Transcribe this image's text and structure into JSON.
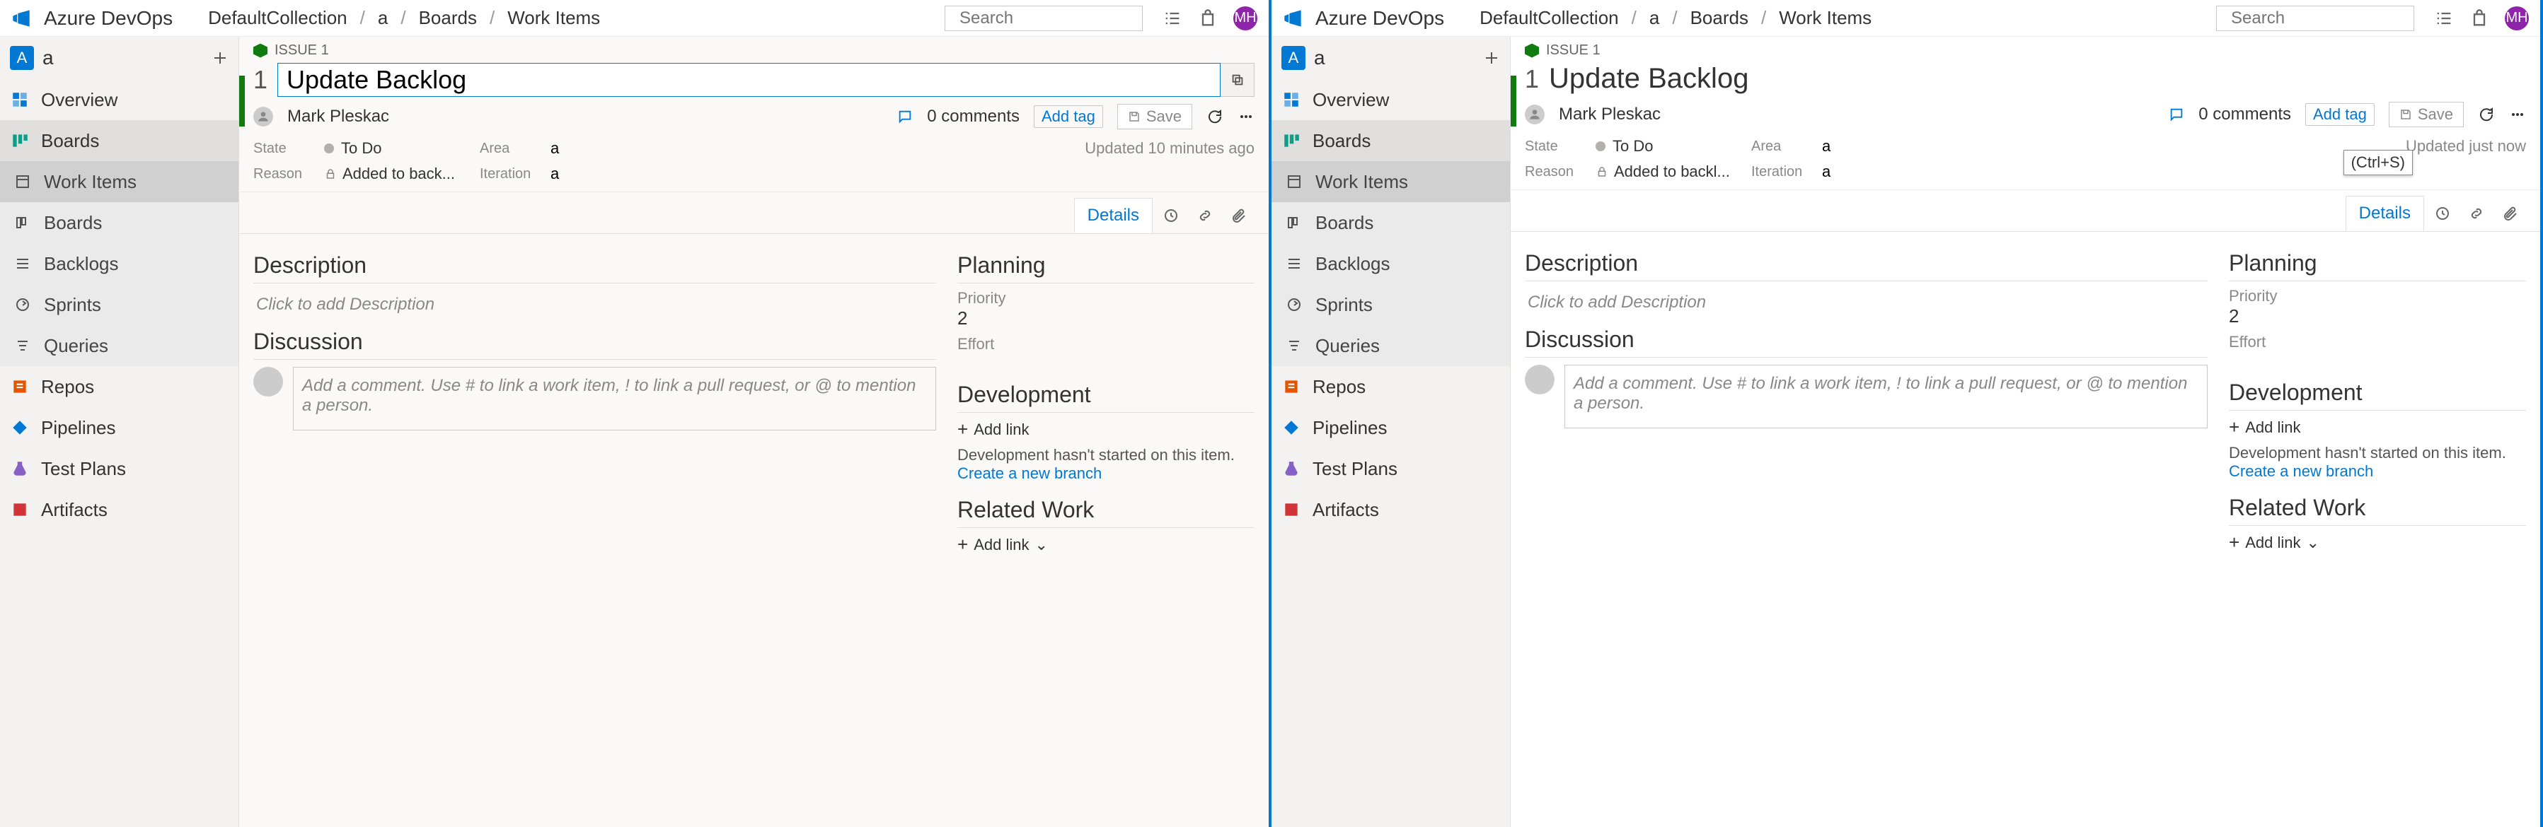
{
  "brand": "Azure DevOps",
  "breadcrumbs": [
    "DefaultCollection",
    "a",
    "Boards",
    "Work Items"
  ],
  "search_placeholder": "Search",
  "avatar_initials": "MH",
  "project": {
    "badge": "A",
    "name": "a"
  },
  "nav": {
    "overview": "Overview",
    "boards": "Boards",
    "sub_workitems": "Work Items",
    "sub_boards": "Boards",
    "sub_backlogs": "Backlogs",
    "sub_sprints": "Sprints",
    "sub_queries": "Queries",
    "repos": "Repos",
    "pipelines": "Pipelines",
    "testplans": "Test Plans",
    "artifacts": "Artifacts"
  },
  "work_item": {
    "tag": "ISSUE 1",
    "id": "1",
    "title": "Update Backlog",
    "assignee": "Mark Pleskac",
    "comments": "0 comments",
    "add_tag": "Add tag",
    "save": "Save",
    "state_lbl": "State",
    "state_val": "To Do",
    "area_lbl": "Area",
    "area_val": "a",
    "reason_lbl": "Reason",
    "reason_left": "Added to back...",
    "reason_right": "Added to backl...",
    "iteration_lbl": "Iteration",
    "iteration_val": "a",
    "updated_left": "Updated 10 minutes ago",
    "updated_right": "Updated just now",
    "details_tab": "Details",
    "description_hdr": "Description",
    "description_ph": "Click to add Description",
    "discussion_hdr": "Discussion",
    "comment_ph": "Add a comment. Use # to link a work item, ! to link a pull request, or @ to mention a person.",
    "planning_hdr": "Planning",
    "priority_lbl": "Priority",
    "priority_val": "2",
    "effort_lbl": "Effort",
    "development_hdr": "Development",
    "add_link": "Add link",
    "dev_msg": "Development hasn't started on this item.",
    "create_branch": "Create a new branch",
    "related_hdr": "Related Work",
    "tooltip": "(Ctrl+S)"
  }
}
